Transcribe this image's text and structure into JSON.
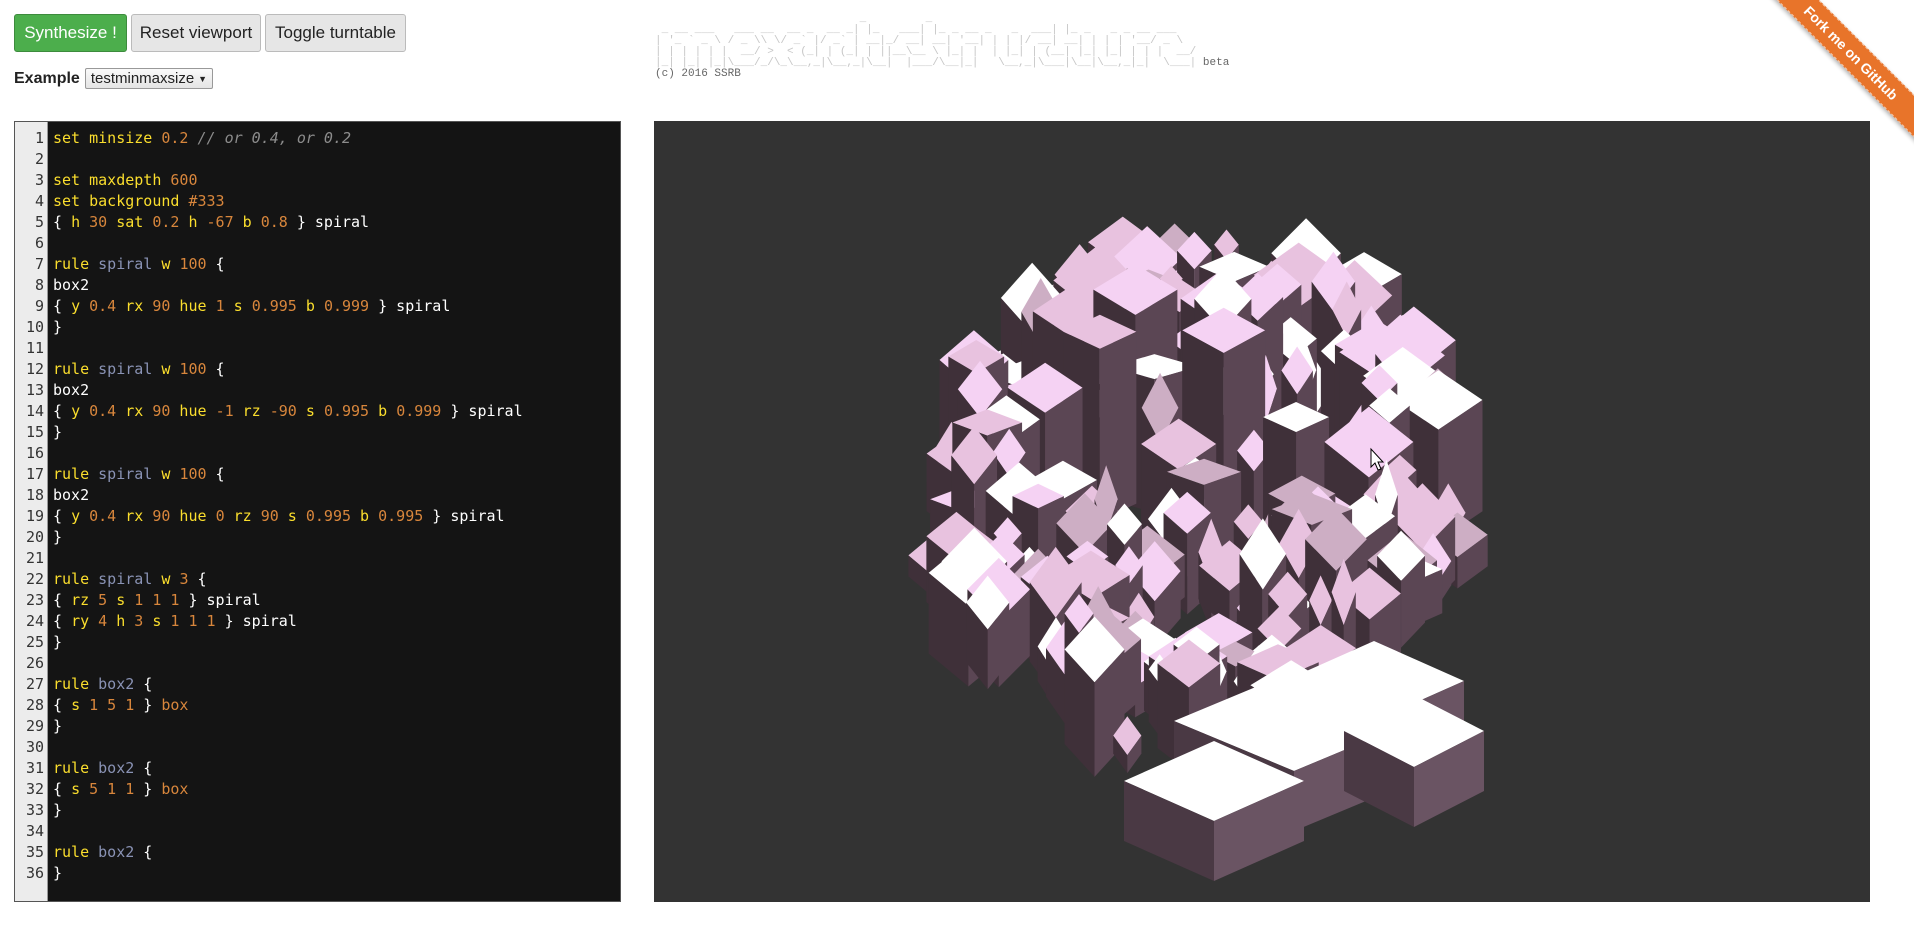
{
  "toolbar": {
    "synthesize_label": "Synthesize !",
    "reset_label": "Reset viewport",
    "turntable_label": "Toggle turntable"
  },
  "example": {
    "label": "Example",
    "selected": "testminmaxsize"
  },
  "logo": {
    "copyright": "(c) 2016 SSRB",
    "badge": "beta"
  },
  "ribbon": {
    "text": "Fork me on GitHub"
  },
  "editor": {
    "lines": [
      [
        {
          "t": "set minsize ",
          "c": "kw"
        },
        {
          "t": "0.2",
          "c": "num"
        },
        {
          "t": " // or 0.4, or 0.2",
          "c": "cm"
        }
      ],
      [],
      [
        {
          "t": "set maxdepth ",
          "c": "kw"
        },
        {
          "t": "600",
          "c": "num"
        }
      ],
      [
        {
          "t": "set background ",
          "c": "kw"
        },
        {
          "t": "#333",
          "c": "num"
        }
      ],
      [
        {
          "t": "{ ",
          "c": "plain"
        },
        {
          "t": "h ",
          "c": "kw"
        },
        {
          "t": "30",
          "c": "num"
        },
        {
          "t": " sat ",
          "c": "kw"
        },
        {
          "t": "0.2",
          "c": "num"
        },
        {
          "t": " h ",
          "c": "kw"
        },
        {
          "t": "-67",
          "c": "num"
        },
        {
          "t": " b ",
          "c": "kw"
        },
        {
          "t": "0.8",
          "c": "num"
        },
        {
          "t": " } spiral",
          "c": "plain"
        }
      ],
      [],
      [
        {
          "t": "rule ",
          "c": "kw"
        },
        {
          "t": "spiral",
          "c": "name"
        },
        {
          "t": " w ",
          "c": "kw"
        },
        {
          "t": "100",
          "c": "num"
        },
        {
          "t": " {",
          "c": "plain"
        }
      ],
      [
        {
          "t": "box2",
          "c": "plain"
        }
      ],
      [
        {
          "t": "{ ",
          "c": "plain"
        },
        {
          "t": "y ",
          "c": "kw"
        },
        {
          "t": "0.4",
          "c": "num"
        },
        {
          "t": " rx ",
          "c": "kw"
        },
        {
          "t": "90",
          "c": "num"
        },
        {
          "t": " hue ",
          "c": "kw"
        },
        {
          "t": "1",
          "c": "num"
        },
        {
          "t": " s ",
          "c": "kw"
        },
        {
          "t": "0.995",
          "c": "num"
        },
        {
          "t": " b ",
          "c": "kw"
        },
        {
          "t": "0.999",
          "c": "num"
        },
        {
          "t": " } spiral",
          "c": "plain"
        }
      ],
      [
        {
          "t": "}",
          "c": "plain"
        }
      ],
      [],
      [
        {
          "t": "rule ",
          "c": "kw"
        },
        {
          "t": "spiral",
          "c": "name"
        },
        {
          "t": " w ",
          "c": "kw"
        },
        {
          "t": "100",
          "c": "num"
        },
        {
          "t": " {",
          "c": "plain"
        }
      ],
      [
        {
          "t": "box2",
          "c": "plain"
        }
      ],
      [
        {
          "t": "{ ",
          "c": "plain"
        },
        {
          "t": "y ",
          "c": "kw"
        },
        {
          "t": "0.4",
          "c": "num"
        },
        {
          "t": " rx ",
          "c": "kw"
        },
        {
          "t": "90",
          "c": "num"
        },
        {
          "t": " hue ",
          "c": "kw"
        },
        {
          "t": "-1",
          "c": "num"
        },
        {
          "t": " rz ",
          "c": "kw"
        },
        {
          "t": "-90",
          "c": "num"
        },
        {
          "t": " s ",
          "c": "kw"
        },
        {
          "t": "0.995",
          "c": "num"
        },
        {
          "t": " b ",
          "c": "kw"
        },
        {
          "t": "0.999",
          "c": "num"
        },
        {
          "t": " } spiral",
          "c": "plain"
        }
      ],
      [
        {
          "t": "}",
          "c": "plain"
        }
      ],
      [],
      [
        {
          "t": "rule ",
          "c": "kw"
        },
        {
          "t": "spiral",
          "c": "name"
        },
        {
          "t": " w ",
          "c": "kw"
        },
        {
          "t": "100",
          "c": "num"
        },
        {
          "t": " {",
          "c": "plain"
        }
      ],
      [
        {
          "t": "box2",
          "c": "plain"
        }
      ],
      [
        {
          "t": "{ ",
          "c": "plain"
        },
        {
          "t": "y ",
          "c": "kw"
        },
        {
          "t": "0.4",
          "c": "num"
        },
        {
          "t": " rx ",
          "c": "kw"
        },
        {
          "t": "90",
          "c": "num"
        },
        {
          "t": " hue ",
          "c": "kw"
        },
        {
          "t": "0",
          "c": "num"
        },
        {
          "t": " rz ",
          "c": "kw"
        },
        {
          "t": "90",
          "c": "num"
        },
        {
          "t": " s ",
          "c": "kw"
        },
        {
          "t": "0.995",
          "c": "num"
        },
        {
          "t": " b ",
          "c": "kw"
        },
        {
          "t": "0.995",
          "c": "num"
        },
        {
          "t": " } spiral",
          "c": "plain"
        }
      ],
      [
        {
          "t": "}",
          "c": "plain"
        }
      ],
      [],
      [
        {
          "t": "rule ",
          "c": "kw"
        },
        {
          "t": "spiral",
          "c": "name"
        },
        {
          "t": " w ",
          "c": "kw"
        },
        {
          "t": "3",
          "c": "num"
        },
        {
          "t": " {",
          "c": "plain"
        }
      ],
      [
        {
          "t": "{ ",
          "c": "plain"
        },
        {
          "t": "rz ",
          "c": "kw"
        },
        {
          "t": "5",
          "c": "num"
        },
        {
          "t": " s ",
          "c": "kw"
        },
        {
          "t": "1 1 1",
          "c": "num"
        },
        {
          "t": " } spiral",
          "c": "plain"
        }
      ],
      [
        {
          "t": "{ ",
          "c": "plain"
        },
        {
          "t": "ry ",
          "c": "kw"
        },
        {
          "t": "4",
          "c": "num"
        },
        {
          "t": " h ",
          "c": "kw"
        },
        {
          "t": "3",
          "c": "num"
        },
        {
          "t": " s ",
          "c": "kw"
        },
        {
          "t": "1 1 1",
          "c": "num"
        },
        {
          "t": " } spiral",
          "c": "plain"
        }
      ],
      [
        {
          "t": "}",
          "c": "plain"
        }
      ],
      [],
      [
        {
          "t": "rule ",
          "c": "kw"
        },
        {
          "t": "box2",
          "c": "name"
        },
        {
          "t": " {",
          "c": "plain"
        }
      ],
      [
        {
          "t": "{ ",
          "c": "plain"
        },
        {
          "t": "s ",
          "c": "kw"
        },
        {
          "t": "1 5 1",
          "c": "num"
        },
        {
          "t": " } ",
          "c": "plain"
        },
        {
          "t": "box",
          "c": "num"
        }
      ],
      [
        {
          "t": "}",
          "c": "plain"
        }
      ],
      [],
      [
        {
          "t": "rule ",
          "c": "kw"
        },
        {
          "t": "box2",
          "c": "name"
        },
        {
          "t": " {",
          "c": "plain"
        }
      ],
      [
        {
          "t": "{ ",
          "c": "plain"
        },
        {
          "t": "s ",
          "c": "kw"
        },
        {
          "t": "5 1 1",
          "c": "num"
        },
        {
          "t": " } ",
          "c": "plain"
        },
        {
          "t": "box",
          "c": "num"
        }
      ],
      [
        {
          "t": "}",
          "c": "plain"
        }
      ],
      [],
      [
        {
          "t": "rule ",
          "c": "kw"
        },
        {
          "t": "box2",
          "c": "name"
        },
        {
          "t": " {",
          "c": "plain"
        }
      ],
      [
        {
          "t": "}",
          "c": "plain"
        }
      ]
    ]
  },
  "colors": {
    "primary_button": "#4cae4c",
    "editor_bg": "#141414",
    "keyword": "#fbde2d",
    "number": "#d8863c",
    "rule_name": "#8a93b5",
    "viewport_bg": "#333333",
    "ribbon": "#e8742a"
  }
}
